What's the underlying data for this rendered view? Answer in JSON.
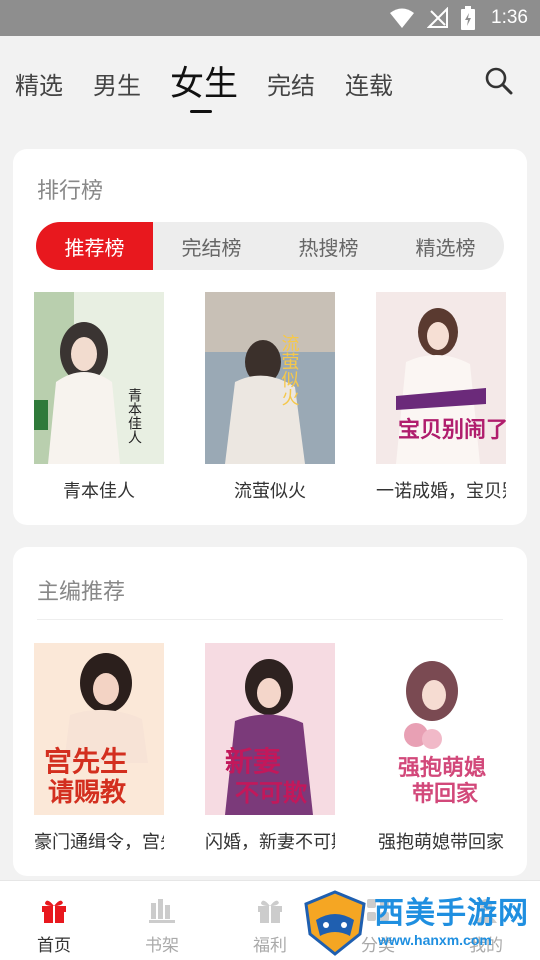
{
  "status_bar": {
    "time": "1:36"
  },
  "top_nav": {
    "tabs": [
      "精选",
      "男生",
      "女生",
      "完结",
      "连载"
    ],
    "active_tab": "女生"
  },
  "ranking": {
    "title": "排行榜",
    "segments": [
      "推荐榜",
      "完结榜",
      "热搜榜",
      "精选榜"
    ],
    "books": [
      {
        "title": "青本佳人"
      },
      {
        "title": "流萤似火"
      },
      {
        "title": "一诺成婚，宝贝别闹了"
      }
    ]
  },
  "editor_picks": {
    "title": "主编推荐",
    "books": [
      {
        "title": "豪门通缉令，宫先生请赐教"
      },
      {
        "title": "闪婚，新妻不可欺"
      },
      {
        "title": "强抱萌媳带回家"
      }
    ]
  },
  "bottom_nav": {
    "items": [
      "首页",
      "书架",
      "福利",
      "分类",
      "我的"
    ],
    "active": "首页"
  },
  "watermark": {
    "text": "西美手游网",
    "url": "www.hanxm.com"
  },
  "colors": {
    "accent": "#e8181e",
    "status_bar": "#8e8e8e",
    "watermark": "#1f8fe0"
  }
}
